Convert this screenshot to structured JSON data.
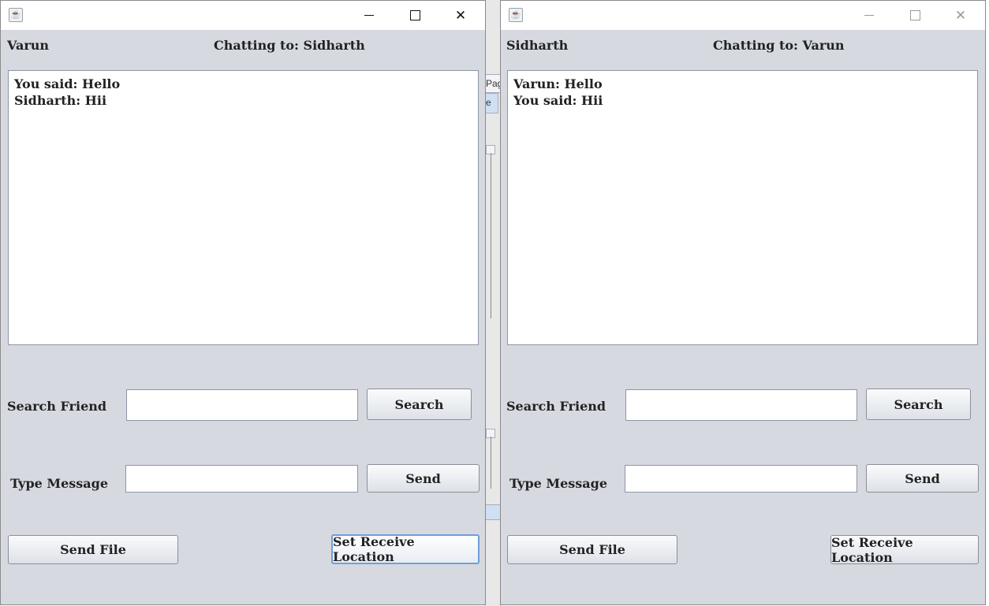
{
  "background_fragments": {
    "tab_text_1": "Pag",
    "tab_text_2": "e"
  },
  "windows": [
    {
      "id": "varun",
      "user_label": "Varun",
      "chatting_to": "Chatting to: Sidharth",
      "messages": [
        "You said: Hello",
        "Sidharth: Hii"
      ],
      "search_label": "Search Friend",
      "search_value": "",
      "search_button": "Search",
      "message_label": "Type Message",
      "message_value": "",
      "send_button": "Send",
      "send_file_button": "Send File",
      "set_receive_button": "Set Receive Location",
      "active": true
    },
    {
      "id": "sidharth",
      "user_label": "Sidharth",
      "chatting_to": "Chatting to: Varun",
      "messages": [
        "Varun: Hello",
        "You said: Hii"
      ],
      "search_label": "Search Friend",
      "search_value": "",
      "search_button": "Search",
      "message_label": "Type Message",
      "message_value": "",
      "send_button": "Send",
      "send_file_button": "Send File",
      "set_receive_button": "Set Receive Location",
      "active": false
    }
  ],
  "icons": {
    "app": "java-icon",
    "minimize": "minimize-icon",
    "maximize": "maximize-icon",
    "close": "close-icon"
  },
  "colors": {
    "window_bg": "#d6d9df",
    "focus_border": "#6f9fd8"
  }
}
